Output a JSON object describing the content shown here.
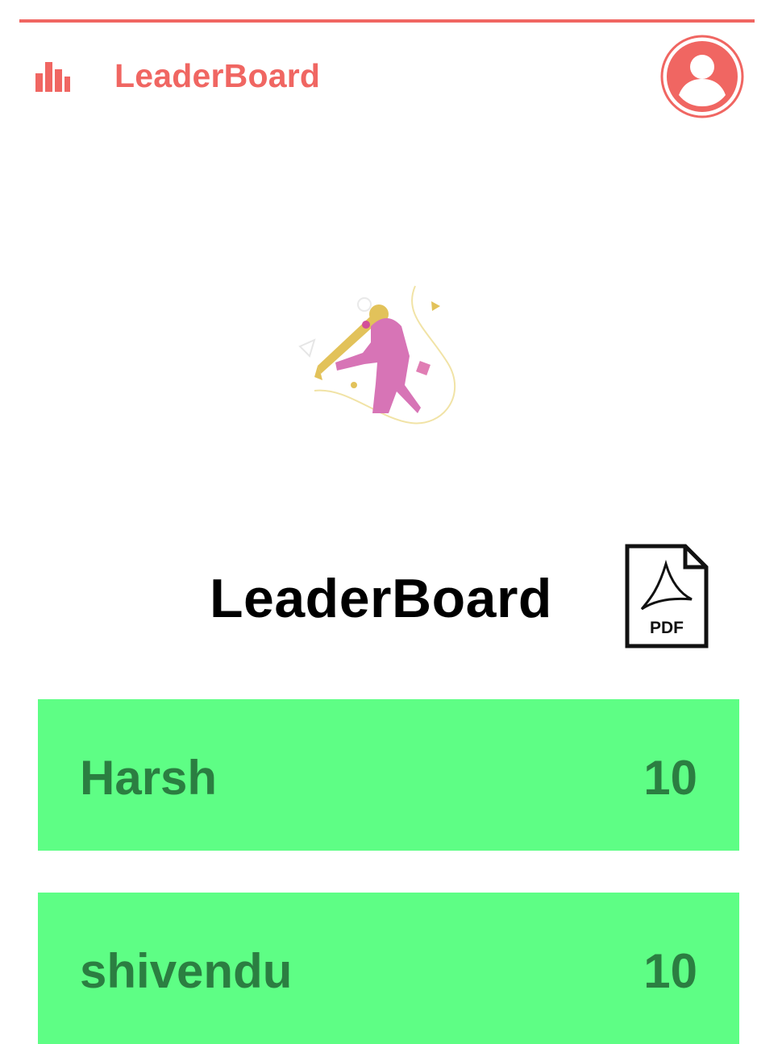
{
  "header": {
    "title": "LeaderBoard",
    "menu_icon": "bar-chart-icon",
    "profile_icon": "user-profile-icon"
  },
  "hero": {
    "illustration": "cricket-batsman-illustration"
  },
  "main": {
    "title": "LeaderBoard",
    "pdf_icon": "pdf-file-icon",
    "pdf_label": "PDF"
  },
  "leaderboard": [
    {
      "name": "Harsh",
      "score": "10"
    },
    {
      "name": "shivendu",
      "score": "10"
    }
  ],
  "colors": {
    "accent": "#f06662",
    "row_background": "#5efe85",
    "row_text": "#2b7e41",
    "title_text": "#000000"
  }
}
